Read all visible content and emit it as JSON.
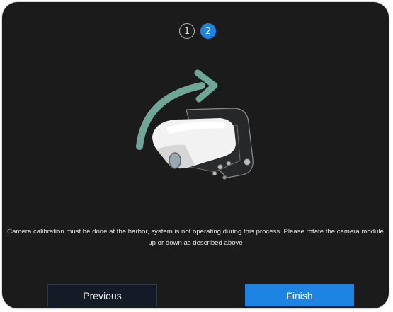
{
  "steps": [
    {
      "label": "1",
      "state": "inactive"
    },
    {
      "label": "2",
      "state": "active"
    }
  ],
  "illustration": {
    "arrow_icon": "rotate-arrow-icon",
    "camera_icon": "camera-module-icon",
    "arrow_color": "#6fa697"
  },
  "instruction_line1": "Camera calibration must be done at the harbor, system is not operating during this process. Please rotate the camera module",
  "instruction_line2": "up or down as described above",
  "buttons": {
    "previous_label": "Previous",
    "finish_label": "Finish"
  },
  "colors": {
    "background": "#1b1b1c",
    "accent": "#1d84e4"
  }
}
